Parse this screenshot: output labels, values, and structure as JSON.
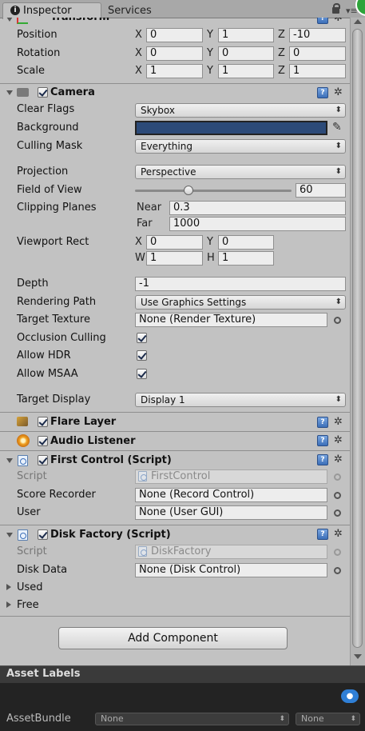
{
  "tabs": {
    "inspector": "Inspector",
    "services": "Services"
  },
  "transform": {
    "title": "Transform",
    "rows": [
      {
        "label": "Position",
        "x": "0",
        "y": "1",
        "z": "-10"
      },
      {
        "label": "Rotation",
        "x": "0",
        "y": "0",
        "z": "0"
      },
      {
        "label": "Scale",
        "x": "1",
        "y": "1",
        "z": "1"
      }
    ]
  },
  "axes": {
    "x": "X",
    "y": "Y",
    "z": "Z",
    "w": "W",
    "h": "H"
  },
  "camera": {
    "title": "Camera",
    "clear_flags": {
      "label": "Clear Flags",
      "value": "Skybox"
    },
    "background": {
      "label": "Background",
      "color": "#2c4a78"
    },
    "culling_mask": {
      "label": "Culling Mask",
      "value": "Everything"
    },
    "projection": {
      "label": "Projection",
      "value": "Perspective"
    },
    "fov": {
      "label": "Field of View",
      "value": "60",
      "slider_fraction": 0.34
    },
    "clipping": {
      "label": "Clipping Planes",
      "near_label": "Near",
      "near": "0.3",
      "far_label": "Far",
      "far": "1000"
    },
    "viewport": {
      "label": "Viewport Rect",
      "x": "0",
      "y": "0",
      "w": "1",
      "h": "1"
    },
    "depth": {
      "label": "Depth",
      "value": "-1"
    },
    "rendering_path": {
      "label": "Rendering Path",
      "value": "Use Graphics Settings"
    },
    "target_texture": {
      "label": "Target Texture",
      "value": "None (Render Texture)"
    },
    "occlusion": {
      "label": "Occlusion Culling",
      "checked": true
    },
    "hdr": {
      "label": "Allow HDR",
      "checked": true
    },
    "msaa": {
      "label": "Allow MSAA",
      "checked": true
    },
    "target_display": {
      "label": "Target Display",
      "value": "Display 1"
    }
  },
  "flare_layer": {
    "title": "Flare Layer"
  },
  "audio_listener": {
    "title": "Audio Listener"
  },
  "first_control": {
    "title": "First Control (Script)",
    "script_label": "Script",
    "script_value": "FirstControl",
    "score_label": "Score Recorder",
    "score_value": "None (Record Control)",
    "user_label": "User",
    "user_value": "None (User GUI)"
  },
  "disk_factory": {
    "title": "Disk Factory (Script)",
    "script_label": "Script",
    "script_value": "DiskFactory",
    "disk_data_label": "Disk Data",
    "disk_data_value": "None (Disk Control)",
    "used_label": "Used",
    "free_label": "Free"
  },
  "add_component": "Add Component",
  "asset_labels": {
    "title": "Asset Labels",
    "bundle_label": "AssetBundle",
    "bundle_value": "None",
    "variant_value": "None"
  },
  "icons": [
    "info-icon",
    "lock-icon",
    "menu-icon",
    "camera-icon",
    "help-icon",
    "gear-icon",
    "eyedropper-icon",
    "object-picker-icon",
    "script-icon",
    "tag-icon",
    "flare-icon",
    "audio-icon"
  ]
}
